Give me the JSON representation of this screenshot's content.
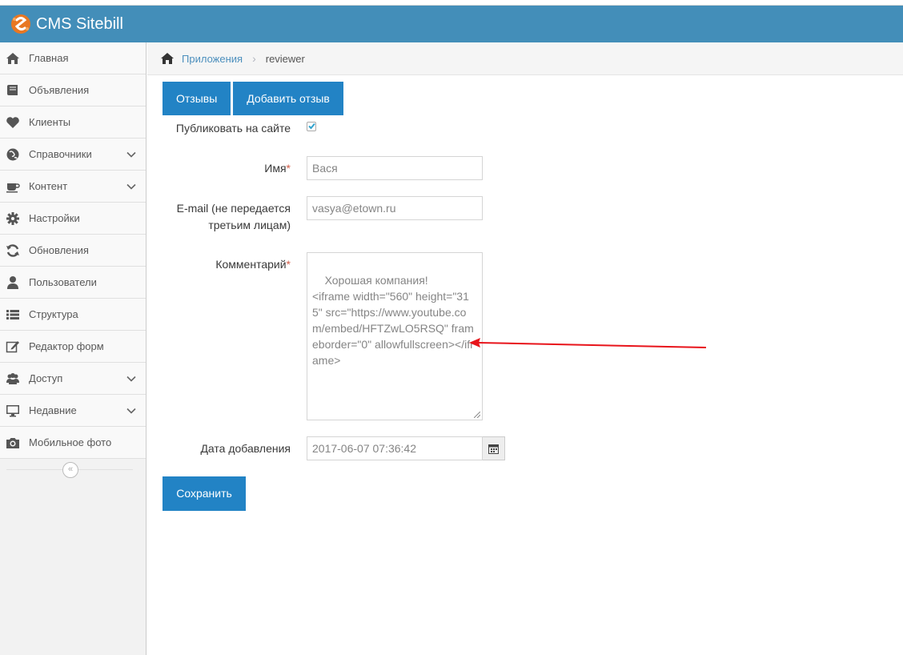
{
  "header": {
    "title": "CMS Sitebill"
  },
  "sidebar": {
    "items": [
      {
        "label": "Главная",
        "icon": "home-icon",
        "has_submenu": false
      },
      {
        "label": "Объявления",
        "icon": "book-icon",
        "has_submenu": false
      },
      {
        "label": "Клиенты",
        "icon": "heart-icon",
        "has_submenu": false
      },
      {
        "label": "Справочники",
        "icon": "globe-icon",
        "has_submenu": true
      },
      {
        "label": "Контент",
        "icon": "coffee-icon",
        "has_submenu": true
      },
      {
        "label": "Настройки",
        "icon": "gear-icon",
        "has_submenu": false
      },
      {
        "label": "Обновления",
        "icon": "refresh-icon",
        "has_submenu": false
      },
      {
        "label": "Пользователи",
        "icon": "user-icon",
        "has_submenu": false
      },
      {
        "label": "Структура",
        "icon": "list-icon",
        "has_submenu": false
      },
      {
        "label": "Редактор форм",
        "icon": "edit-icon",
        "has_submenu": false
      },
      {
        "label": "Доступ",
        "icon": "users-icon",
        "has_submenu": true
      },
      {
        "label": "Недавние",
        "icon": "desktop-icon",
        "has_submenu": true
      },
      {
        "label": "Мобильное фото",
        "icon": "camera-icon",
        "has_submenu": false
      }
    ],
    "collapse_glyph": "«"
  },
  "breadcrumbs": {
    "link": "Приложения",
    "separator": "›",
    "current": "reviewer"
  },
  "tabs": [
    {
      "label": "Отзывы"
    },
    {
      "label": "Добавить отзыв"
    }
  ],
  "form": {
    "publish": {
      "label": "Публиковать на сайте",
      "checked": true
    },
    "name": {
      "label": "Имя",
      "required_mark": "*",
      "value": "Вася"
    },
    "email": {
      "label_line1": "E-mail (не передается",
      "label_line2": "третьим лицам)",
      "value": "vasya@etown.ru"
    },
    "comment": {
      "label": "Комментарий",
      "required_mark": "*",
      "value": "Хорошая компания!\n<iframe width=\"560\" height=\"315\" src=\"https://www.youtube.com/embed/HFTZwLO5RSQ\" frameborder=\"0\" allowfullscreen></iframe>"
    },
    "date": {
      "label": "Дата добавления",
      "value": "2017-06-07 07:36:42"
    },
    "save_label": "Сохранить"
  },
  "colors": {
    "navbar": "#438eb9",
    "button": "#2283c5",
    "link": "#4c8fbd",
    "required": "#d15b47",
    "annotation_arrow": "#e8141b"
  }
}
